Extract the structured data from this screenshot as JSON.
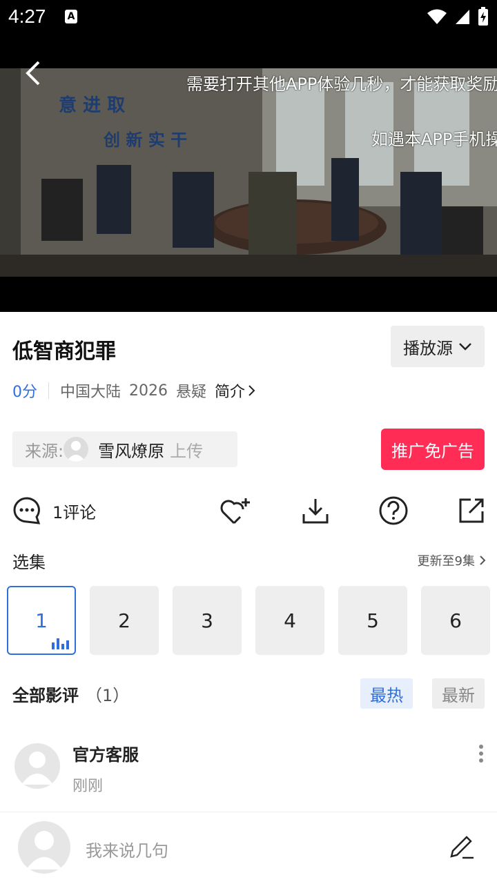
{
  "status": {
    "time": "4:27",
    "notif_icon": "A"
  },
  "video": {
    "marquee_1": "需要打开其他APP体验几秒，才能获取奖励",
    "marquee_2": "如遇本APP手机操作"
  },
  "movie": {
    "title": "低智商犯罪",
    "source_label": "播放源",
    "score": "0分",
    "region": "中国大陆",
    "year": "2026",
    "genre": "悬疑",
    "intro_label": "简介"
  },
  "uploader": {
    "label": "来源:",
    "name": "雪风燎原",
    "action": "上传"
  },
  "promo_label": "推广免广告",
  "actions": {
    "comment_label": "1评论"
  },
  "episodes": {
    "title": "选集",
    "update_text": "更新至9集",
    "items": [
      "1",
      "2",
      "3",
      "4",
      "5",
      "6"
    ]
  },
  "reviews": {
    "title": "全部影评",
    "count": "（1）",
    "sort_hot": "最热",
    "sort_new": "最新",
    "items": [
      {
        "name": "官方客服",
        "time": "刚刚"
      }
    ]
  },
  "composer": {
    "placeholder": "我来说几句"
  },
  "colors": {
    "accent": "#2f6fdc",
    "promo": "#ff2d55"
  }
}
